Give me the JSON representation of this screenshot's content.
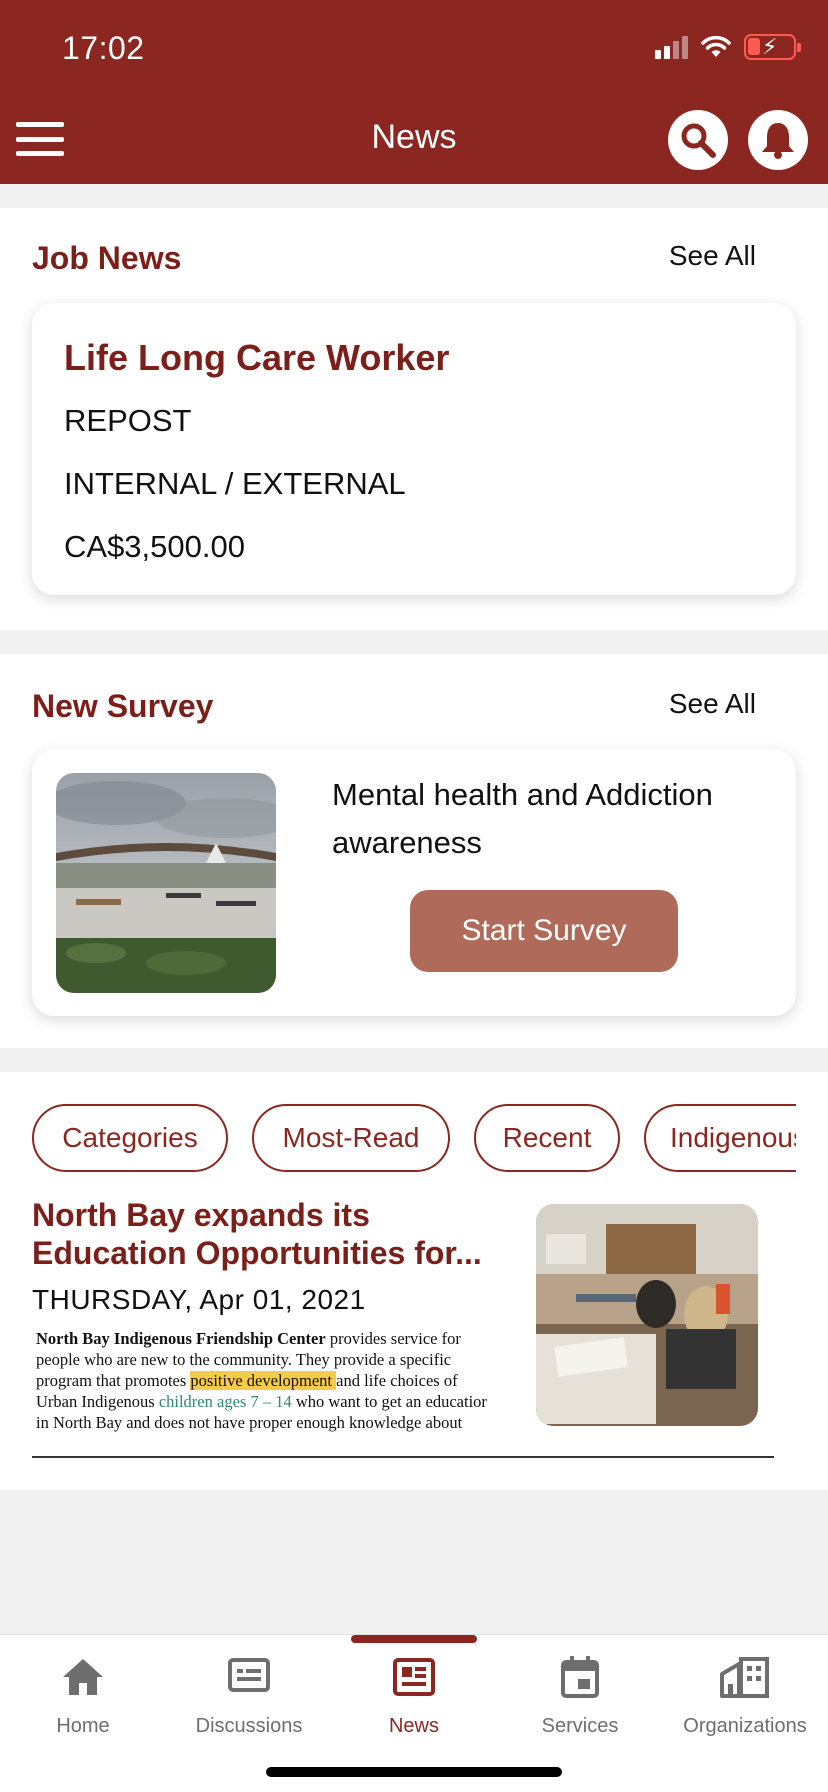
{
  "status_bar": {
    "time": "17:02"
  },
  "header": {
    "title": "News"
  },
  "job_news": {
    "title": "Job News",
    "see_all": "See All",
    "card": {
      "title": "Life Long Care Worker",
      "type": "REPOST",
      "scope": "INTERNAL / EXTERNAL",
      "salary": "CA$3,500.00"
    }
  },
  "survey": {
    "title": "New Survey",
    "see_all": "See All",
    "card": {
      "text": "Mental health and Addiction awareness",
      "button": "Start Survey"
    }
  },
  "news": {
    "chips": [
      "Categories",
      "Most-Read",
      "Recent",
      "Indigenous"
    ],
    "article": {
      "title": "North Bay expands its Education  Opportunities for...",
      "date": "THURSDAY, Apr 01, 2021",
      "excerpt": {
        "l1_bold": "North Bay Indigenous Friendship Center",
        "l1_rest": " provides service for",
        "l2": "people who are new to the community. They provide a specific",
        "l3_pre": "program that promotes ",
        "l3_hl": "positive development ",
        "l3_post": "and life choices of",
        "l4_pre": "Urban Indigenous ",
        "l4_green": "children ages 7 – 14",
        "l4_post": " who want to get an educatior",
        "l5": "in North Bay and does not have proper enough knowledge about"
      }
    }
  },
  "tabbar": {
    "tabs": [
      {
        "label": "Home",
        "icon": "home-icon"
      },
      {
        "label": "Discussions",
        "icon": "discussions-icon"
      },
      {
        "label": "News",
        "icon": "news-icon",
        "active": true
      },
      {
        "label": "Services",
        "icon": "calendar-icon"
      },
      {
        "label": "Organizations",
        "icon": "building-icon"
      }
    ]
  },
  "colors": {
    "brand": "#8b2720",
    "brand_text": "#7a1f19",
    "button": "#b06a5a",
    "tab_inactive": "#6e6e6e"
  }
}
